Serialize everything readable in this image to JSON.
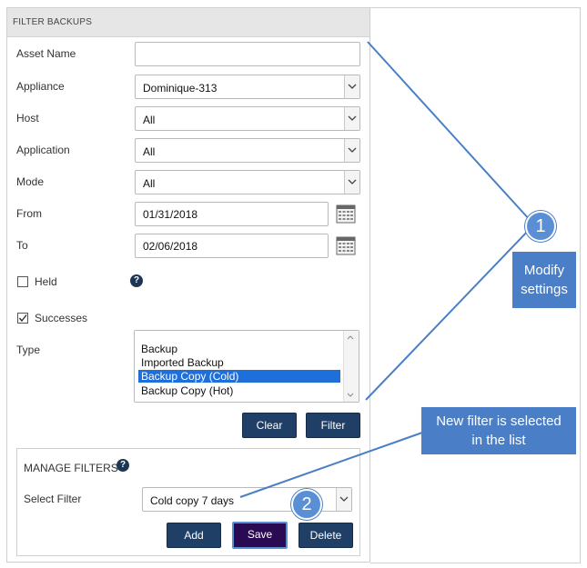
{
  "panel": {
    "title": "FILTER BACKUPS"
  },
  "form": {
    "asset_name": {
      "label": "Asset Name",
      "value": ""
    },
    "appliance": {
      "label": "Appliance",
      "value": "Dominique-313"
    },
    "host": {
      "label": "Host",
      "value": "All"
    },
    "application": {
      "label": "Application",
      "value": "All"
    },
    "mode": {
      "label": "Mode",
      "value": "All"
    },
    "from": {
      "label": "From",
      "value": "01/31/2018"
    },
    "to": {
      "label": "To",
      "value": "02/06/2018"
    },
    "held": {
      "label": "Held",
      "checked": false
    },
    "successes": {
      "label": "Successes",
      "checked": true
    },
    "type": {
      "label": "Type",
      "options": [
        "Backup",
        "Imported Backup",
        "Backup Copy (Cold)",
        "Backup Copy (Hot)"
      ],
      "selected": "Backup Copy (Cold)"
    }
  },
  "buttons": {
    "clear": "Clear",
    "filter": "Filter"
  },
  "manage": {
    "title": "MANAGE FILTERS",
    "select_label": "Select Filter",
    "select_value": "Cold copy 7 days",
    "add": "Add",
    "save": "Save",
    "delete": "Delete"
  },
  "callouts": {
    "one": {
      "number": "1",
      "text_line1": "Modify",
      "text_line2": "settings"
    },
    "two": {
      "number": "2",
      "text_line1": "New filter is selected",
      "text_line2": "in the list"
    }
  },
  "colors": {
    "callout": "#4a7fc7",
    "button": "#1f3f66",
    "save_button": "#2a0a52",
    "selection": "#1e6fd9"
  },
  "icons": {
    "dropdown": "chevron-down-icon",
    "calendar": "calendar-icon",
    "help": "question-circle-icon"
  }
}
